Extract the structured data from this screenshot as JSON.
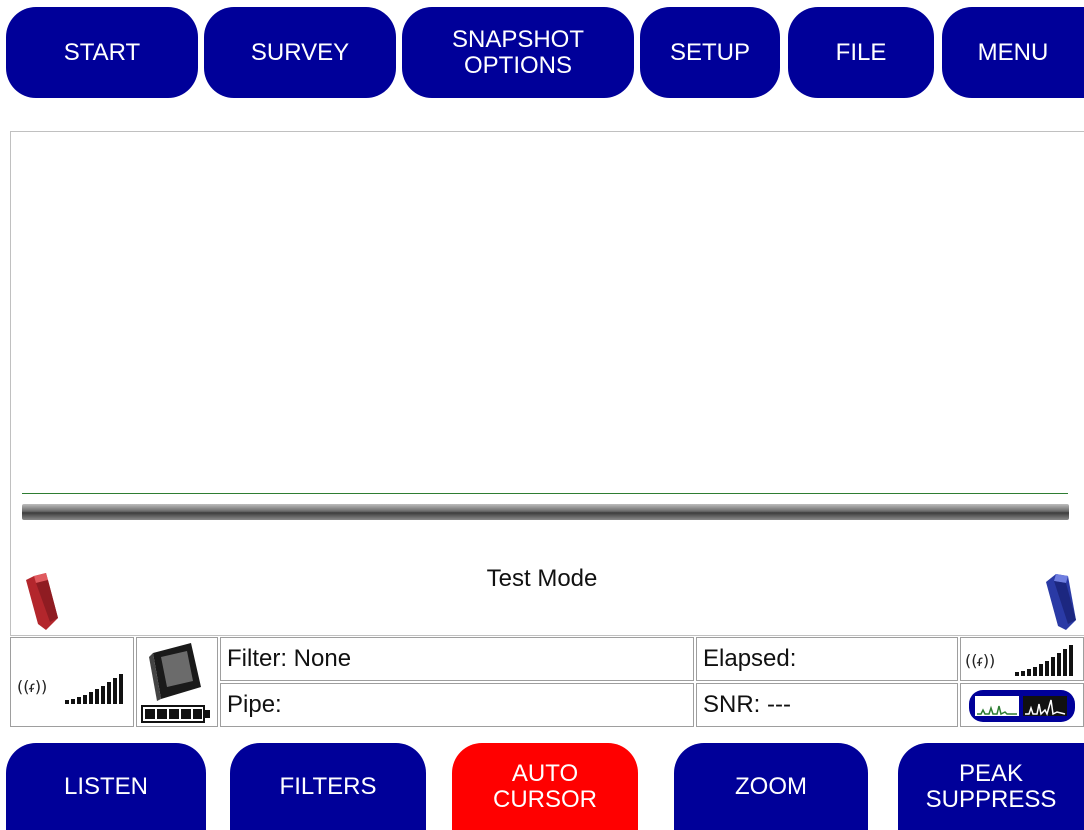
{
  "top_menu": {
    "start": "START",
    "survey": "SURVEY",
    "snapshot_options": "SNAPSHOT\nOPTIONS",
    "setup": "SETUP",
    "file": "FILE",
    "menu": "MENU"
  },
  "plot": {
    "mode_text": "Test Mode"
  },
  "status": {
    "filter": "Filter: None",
    "pipe": "Pipe:",
    "elapsed": "Elapsed:",
    "snr": "SNR: ---",
    "left_signal_level": 1.0,
    "right_signal_level": 1.0,
    "battery_level": 1.0
  },
  "icons": {
    "left_sensor": "red-sensor-icon",
    "right_sensor": "blue-sensor-icon",
    "left_signal": "wireless-signal-icon",
    "right_signal": "wireless-signal-icon",
    "device": "handheld-device-icon",
    "battery": "battery-icon",
    "spectrum": "spectrum-toggle-icon"
  },
  "colors": {
    "button": "#000099",
    "active_button": "#ff0000",
    "trace": "#2e7d32"
  },
  "bottom_menu": {
    "listen": "LISTEN",
    "filters": "FILTERS",
    "auto_cursor": "AUTO\nCURSOR",
    "zoom": "ZOOM",
    "peak_suppress": "PEAK\nSUPPRESS"
  }
}
